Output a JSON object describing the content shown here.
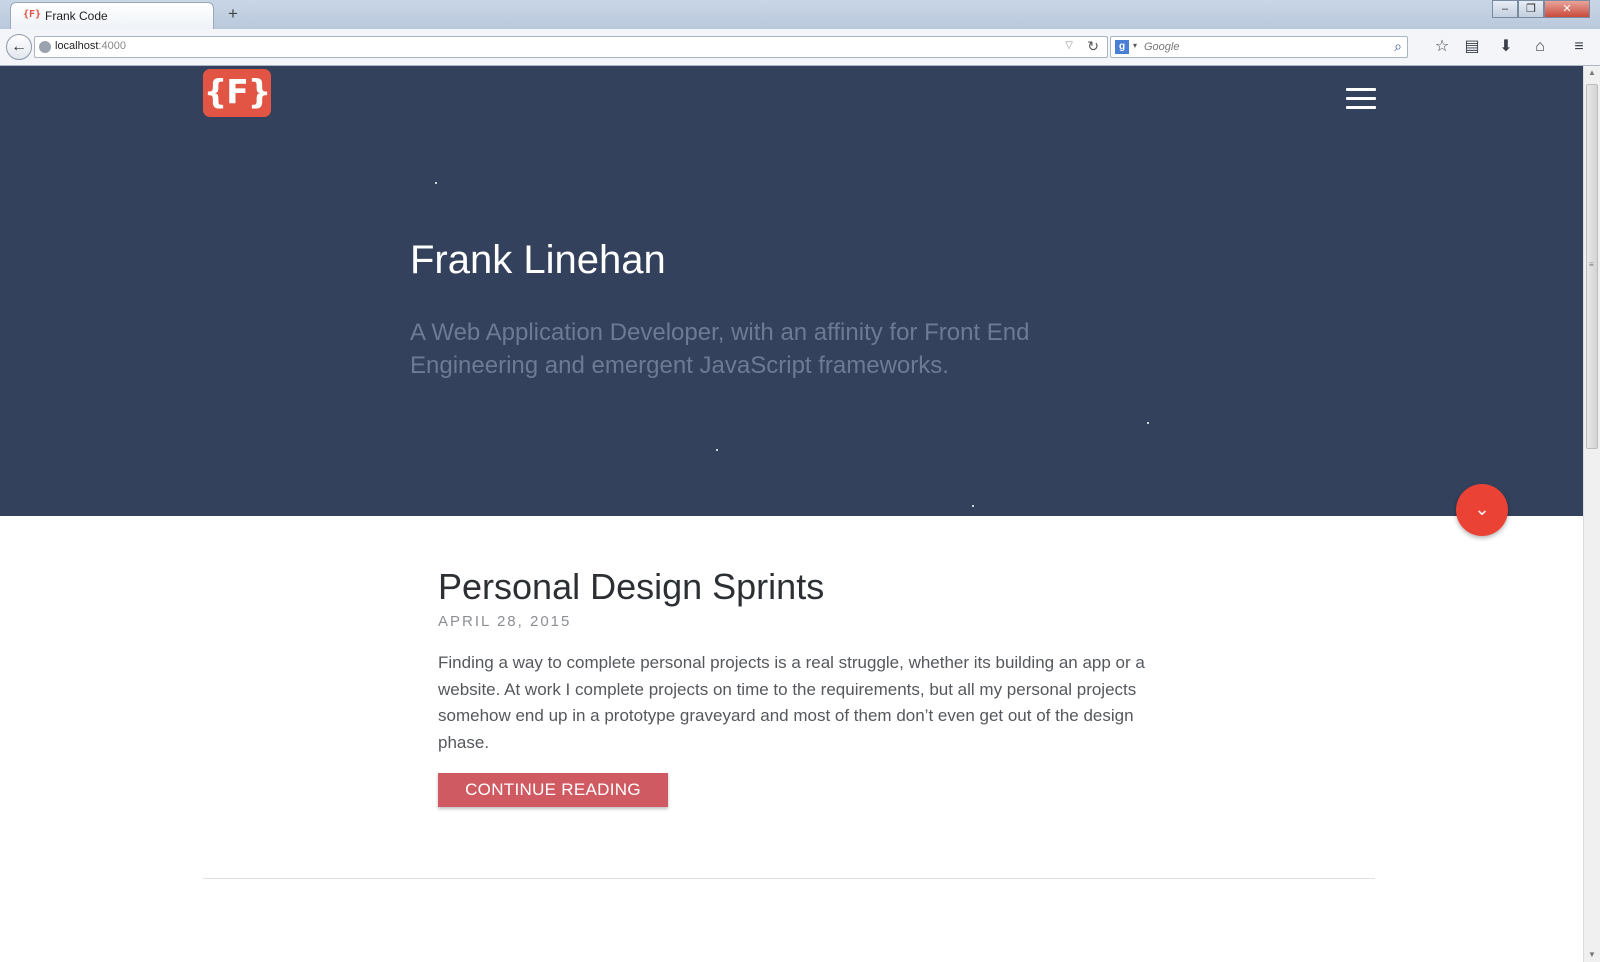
{
  "browser": {
    "tab_favicon": "{F}",
    "tab_title": "Frank Code",
    "new_tab": "+",
    "url_host": "localhost",
    "url_port": ":4000",
    "search_placeholder": "Google",
    "search_engine_badge": "g",
    "icons": [
      "back-arrow-icon",
      "globe-icon",
      "reload-icon",
      "search-icon",
      "bookmark-star-icon",
      "reading-list-icon",
      "download-icon",
      "home-icon",
      "menu-icon"
    ]
  },
  "window_controls": {
    "minimize": "–",
    "restore": "❐",
    "close": "✕"
  },
  "header": {
    "logo_text": "{F}",
    "logo_color": "#e25443"
  },
  "hero": {
    "name": "Frank Linehan",
    "tagline": "A Web Application Developer, with an affinity for Front End Engineering and emergent JavaScript frameworks.",
    "background": "#33415c"
  },
  "scroll_button": {
    "icon": "chevron-down-icon",
    "color": "#ea4335"
  },
  "post": {
    "title": "Personal Design Sprints",
    "date": "APRIL 28, 2015",
    "excerpt": "Finding a way to complete personal projects is a real struggle, whether its building an app or a website. At work I complete projects on time to the requirements, but all my personal projects somehow end up in a prototype graveyard and most of them don’t even get out of the design phase.",
    "button_label": "CONTINUE READING",
    "button_color": "#d05a62"
  }
}
